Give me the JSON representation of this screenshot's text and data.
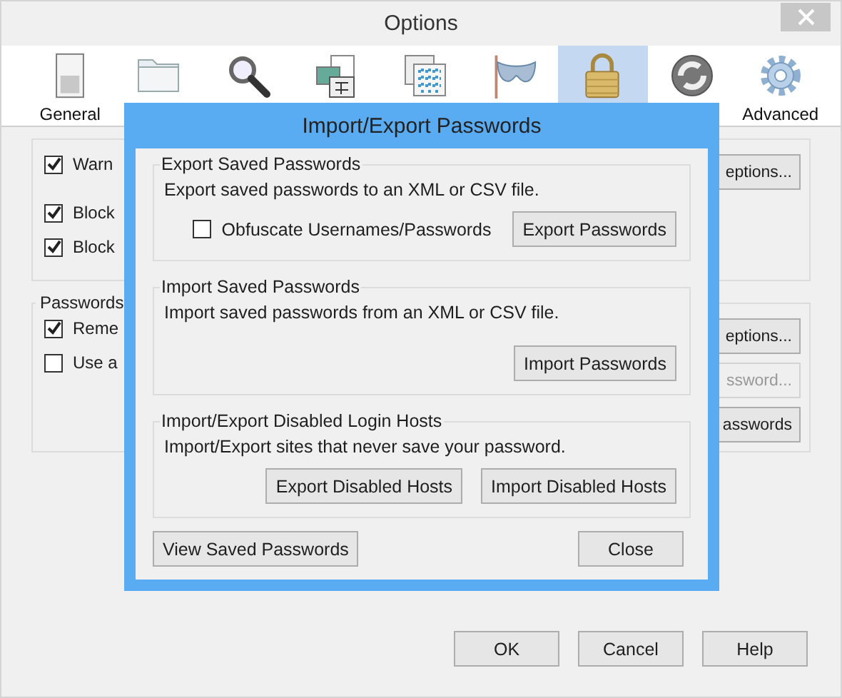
{
  "window": {
    "title": "Options"
  },
  "tabs": [
    {
      "label": "General",
      "selected": false
    },
    {
      "selected": false
    },
    {
      "selected": false
    },
    {
      "selected": false
    },
    {
      "selected": false
    },
    {
      "selected": false
    },
    {
      "selected": true
    },
    {
      "selected": false
    },
    {
      "label": "Advanced",
      "selected": false
    }
  ],
  "group1": {
    "checkboxes": [
      {
        "label": "Warn",
        "checked": true
      },
      {
        "label": "Block",
        "checked": true
      },
      {
        "label": "Block",
        "checked": true
      }
    ],
    "button": "eptions..."
  },
  "passwords": {
    "title": "Passwords",
    "checkboxes": [
      {
        "label": "Reme",
        "checked": true
      },
      {
        "label": "Use a",
        "checked": false
      }
    ],
    "buttons": [
      {
        "label": "eptions...",
        "disabled": false
      },
      {
        "label": "ssword...",
        "disabled": true
      },
      {
        "label": "asswords",
        "disabled": false
      }
    ]
  },
  "dialog": {
    "title": "Import/Export Passwords",
    "export": {
      "title": "Export Saved Passwords",
      "text": "Export saved passwords to an XML or CSV file.",
      "checkbox": {
        "label": "Obfuscate Usernames/Passwords",
        "checked": false
      },
      "button": "Export Passwords"
    },
    "import": {
      "title": "Import Saved Passwords",
      "text": "Import saved passwords from an XML or CSV file.",
      "button": "Import Passwords"
    },
    "hosts": {
      "title": "Import/Export Disabled Login Hosts",
      "text": "Import/Export sites that never save your password.",
      "buttons": [
        "Export Disabled Hosts",
        "Import Disabled Hosts"
      ]
    },
    "view_button": "View Saved Passwords",
    "close_button": "Close"
  },
  "buttons": [
    "OK",
    "Cancel",
    "Help"
  ]
}
